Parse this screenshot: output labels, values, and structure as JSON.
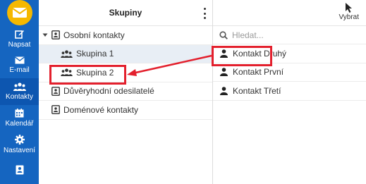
{
  "rail": {
    "items": [
      {
        "label": "Napsat",
        "icon": "compose-icon"
      },
      {
        "label": "E-mail",
        "icon": "envelope-icon"
      },
      {
        "label": "Kontakty",
        "icon": "people-icon"
      },
      {
        "label": "Kalendář",
        "icon": "calendar-icon"
      },
      {
        "label": "Nastavení",
        "icon": "gear-icon"
      },
      {
        "label": "",
        "icon": "contact-card-icon"
      }
    ],
    "active": "Kontakty"
  },
  "groups": {
    "title": "Skupiny",
    "tree": [
      {
        "label": "Osobní kontakty",
        "icon": "contact-card-icon",
        "expanded": true
      },
      {
        "label": "Skupina 1",
        "icon": "group-icon"
      },
      {
        "label": "Skupina 2",
        "icon": "group-icon"
      },
      {
        "label": "Důvěryhodní odesilatelé",
        "icon": "contact-card-icon"
      },
      {
        "label": "Doménové kontakty",
        "icon": "contact-card-icon"
      }
    ]
  },
  "contacts": {
    "select_label": "Vybrat",
    "search_placeholder": "Hledat...",
    "list": [
      {
        "name": "Kontakt Druhý"
      },
      {
        "name": "Kontakt První"
      },
      {
        "name": "Kontakt Třetí"
      }
    ]
  },
  "colors": {
    "rail": "#1565c0",
    "rail_active": "#0d56b0",
    "logo": "#f5b800",
    "selected_row": "#e8eef5",
    "annotation": "#e3202d"
  }
}
